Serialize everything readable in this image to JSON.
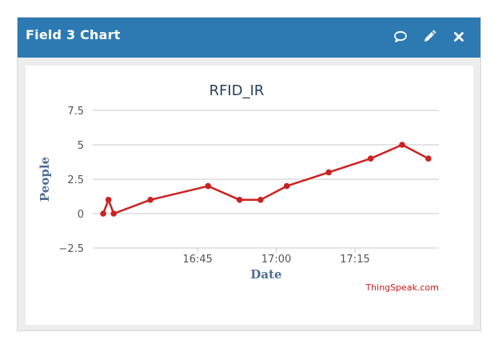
{
  "widget": {
    "title": "Field 3 Chart",
    "header_color": "#2d7ab3",
    "icons": [
      "comment-icon",
      "edit-icon",
      "close-icon"
    ]
  },
  "credit": "ThingSpeak.com",
  "chart_data": {
    "type": "line",
    "title": "RFID_IR",
    "xlabel": "Date",
    "ylabel": "People",
    "ylim": [
      -2.5,
      7.5
    ],
    "yticks": [
      "7.5",
      "5",
      "2.5",
      "0",
      "−2.5"
    ],
    "xtick_labels": [
      "16:45",
      "17:00",
      "17:15"
    ],
    "grid": "horizontal",
    "series_color": "#cc2222",
    "series": [
      {
        "x": [
          "16:27",
          "16:28",
          "16:29",
          "16:36",
          "16:47",
          "16:53",
          "16:57",
          "17:02",
          "17:10",
          "17:18",
          "17:24",
          "17:29"
        ],
        "values": [
          0,
          1,
          0,
          1,
          2,
          1,
          1,
          2,
          3,
          4,
          5,
          4
        ]
      }
    ]
  }
}
